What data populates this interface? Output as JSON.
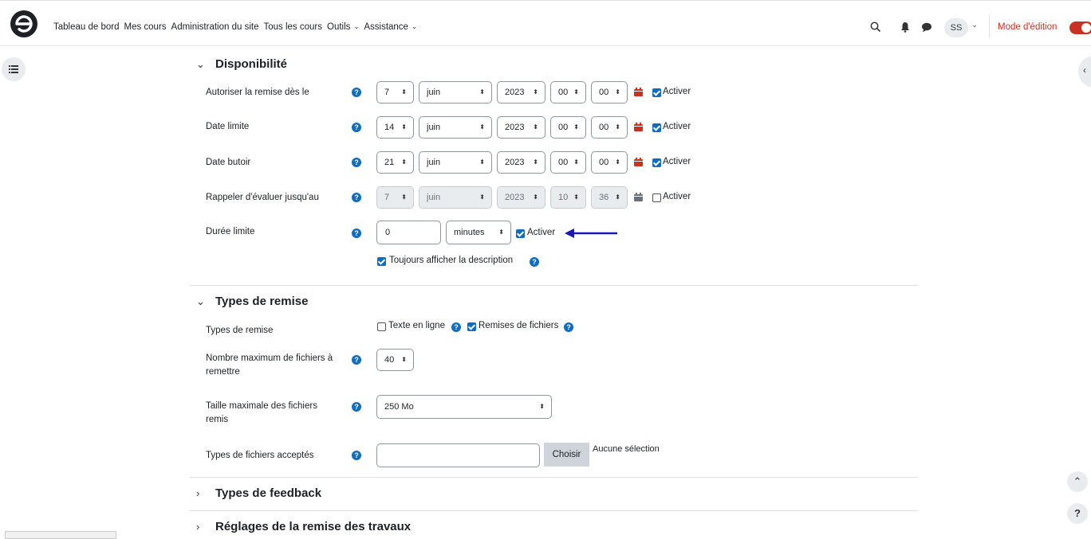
{
  "nav": {
    "items": [
      "Tableau de bord",
      "Mes cours",
      "Administration du site",
      "Tous les cours",
      "Outils",
      "Assistance"
    ],
    "avatar_initials": "SS",
    "edit_mode_label": "Mode d'édition"
  },
  "colors": {
    "accent": "#0f6cbf",
    "edit_mode": "#ca3120"
  },
  "icons": [
    "logo",
    "search-icon",
    "bell-icon",
    "chat-icon",
    "list-icon",
    "calendar-icon",
    "help-icon"
  ],
  "sections": {
    "availability": {
      "title": "Disponibilité",
      "rows": [
        {
          "label": "Autoriser la remise dès le",
          "day": "7",
          "month": "juin",
          "year": "2023",
          "hour": "00",
          "minute": "00",
          "enabled": true
        },
        {
          "label": "Date limite",
          "day": "14",
          "month": "juin",
          "year": "2023",
          "hour": "00",
          "minute": "00",
          "enabled": true
        },
        {
          "label": "Date butoir",
          "day": "21",
          "month": "juin",
          "year": "2023",
          "hour": "00",
          "minute": "00",
          "enabled": true
        },
        {
          "label": "Rappeler d'évaluer jusqu'au",
          "day": "7",
          "month": "juin",
          "year": "2023",
          "hour": "10",
          "minute": "36",
          "enabled": false
        }
      ],
      "enable_label": "Activer",
      "time_limit": {
        "label": "Durée limite",
        "value": "0",
        "unit": "minutes",
        "enabled": true
      },
      "always_show_description": "Toujours afficher la description"
    },
    "submission_types": {
      "title": "Types de remise",
      "types_label": "Types de remise",
      "online_text": "Texte en ligne",
      "file_submissions": "Remises de fichiers",
      "max_files_label_1": "Nombre maximum de fichiers à",
      "max_files_label_2": "remettre",
      "max_files_value": "40",
      "max_size_label_1": "Taille maximale des fichiers",
      "max_size_label_2": "remis",
      "max_size_value": "250 Mo",
      "accepted_types_label": "Types de fichiers acceptés",
      "choose_button": "Choisir",
      "no_selection": "Aucune sélection"
    },
    "feedback_types": {
      "title": "Types de feedback"
    },
    "submission_settings": {
      "title": "Réglages de la remise des travaux"
    }
  },
  "help_button": "?"
}
